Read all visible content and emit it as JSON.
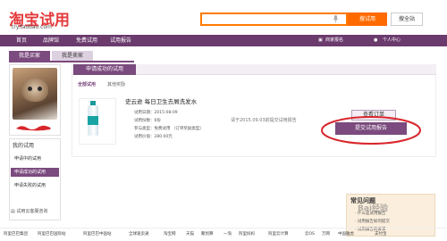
{
  "header": {
    "logo_text": "淘宝试用",
    "logo_url": "try.taobao.com",
    "search_button": "搜试用",
    "fullsite_button": "搜全站",
    "mic_icon": "microphone-icon"
  },
  "nav": {
    "items": [
      "首页",
      "品牌馆",
      "免费试用",
      "试用报告"
    ],
    "right": [
      "商家报名",
      "个人中心"
    ]
  },
  "tabs": [
    "我是买家",
    "我是卖家"
  ],
  "left_menu": {
    "title": "我的试用",
    "items": [
      "申请中的试用",
      "申请成功的试用",
      "申请失败的试用"
    ],
    "active_index": 1,
    "footer": "试用云客服咨询"
  },
  "panel": {
    "tab": "申请成功的试用",
    "subtabs": [
      "全部试用",
      "其他奖励"
    ],
    "product_title": "史云逊 每日卫生去屑洗发水",
    "fields": [
      "试用日期：2015-08-09",
      "试用份数：6份",
      "参与类型：免费试用 （订单奖励类型）",
      "试用价值：280.00元"
    ],
    "note": "请于2015.09.03前提交试用报告",
    "btn_view_order": "查看订单",
    "btn_submit_report": "提交试用报告"
  },
  "faq": {
    "title": "常见问题",
    "items": [
      "什么是试用报告",
      "试用报告如何提交",
      "试用报告的要求"
    ],
    "watermark": "Bai经验"
  },
  "footer_links": [
    "阿里巴巴集团",
    "阿里巴巴国际站",
    "阿里巴巴中国站",
    "全球速卖通",
    "淘宝网",
    "天猫",
    "聚划算",
    "一淘",
    "阿里妈妈",
    "阿里云计算",
    "云OS",
    "万网",
    "中国雅虎",
    "支付宝"
  ],
  "colors": {
    "brand_red": "#e4393c",
    "nav_purple": "#6b3b6e",
    "accent_orange": "#ff6a00"
  }
}
